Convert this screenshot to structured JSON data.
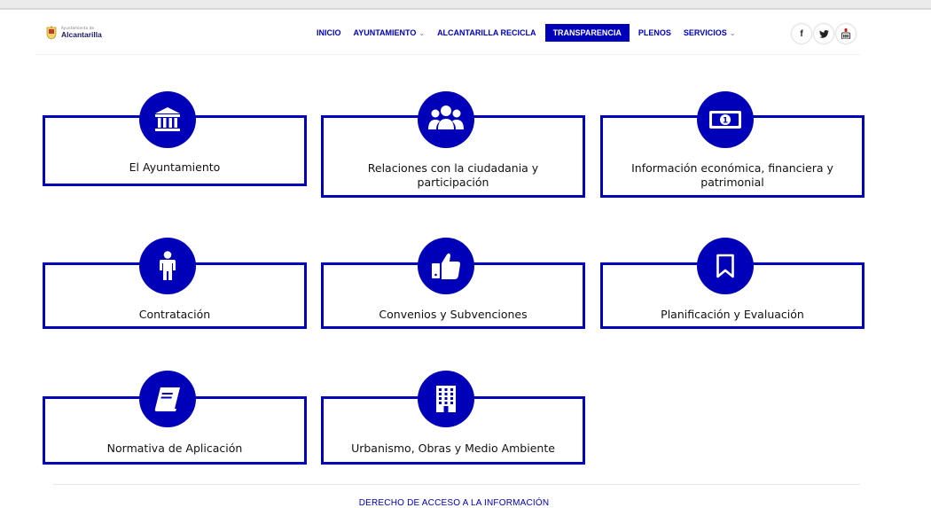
{
  "header": {
    "logo_small": "Ayuntamiento de",
    "logo_name": "Alcantarilla",
    "nav": [
      {
        "label": "INICIO",
        "dropdown": false,
        "active": false
      },
      {
        "label": "AYUNTAMIENTO",
        "dropdown": true,
        "active": false
      },
      {
        "label": "ALCANTARILLA RECICLA",
        "dropdown": false,
        "active": false
      },
      {
        "label": "TRANSPARENCIA",
        "dropdown": false,
        "active": true
      },
      {
        "label": "PLENOS",
        "dropdown": false,
        "active": false
      },
      {
        "label": "SERVICIOS",
        "dropdown": true,
        "active": false
      }
    ],
    "social": [
      {
        "name": "facebook-icon",
        "glyph": "f"
      },
      {
        "name": "twitter-icon"
      },
      {
        "name": "youtube-icon"
      }
    ]
  },
  "cards": [
    {
      "label": "El Ayuntamiento",
      "icon": "building-icon"
    },
    {
      "label": "Relaciones con la ciudadania y participación",
      "icon": "people-icon"
    },
    {
      "label": "Información económica, financiera y patrimonial",
      "icon": "banknote-icon"
    },
    {
      "label": "Contratación",
      "icon": "person-icon"
    },
    {
      "label": "Convenios y Subvenciones",
      "icon": "thumbs-up-icon"
    },
    {
      "label": "Planificación y Evaluación",
      "icon": "bookmark-icon"
    },
    {
      "label": "Normativa de Aplicación",
      "icon": "book-icon"
    },
    {
      "label": "Urbanismo, Obras y Medio Ambiente",
      "icon": "office-building-icon"
    }
  ],
  "footer": {
    "link": "DERECHO DE ACCESO A LA INFORMACIÓN"
  },
  "colors": {
    "accent": "#0000b8",
    "text": "#111111",
    "background": "#ffffff"
  }
}
